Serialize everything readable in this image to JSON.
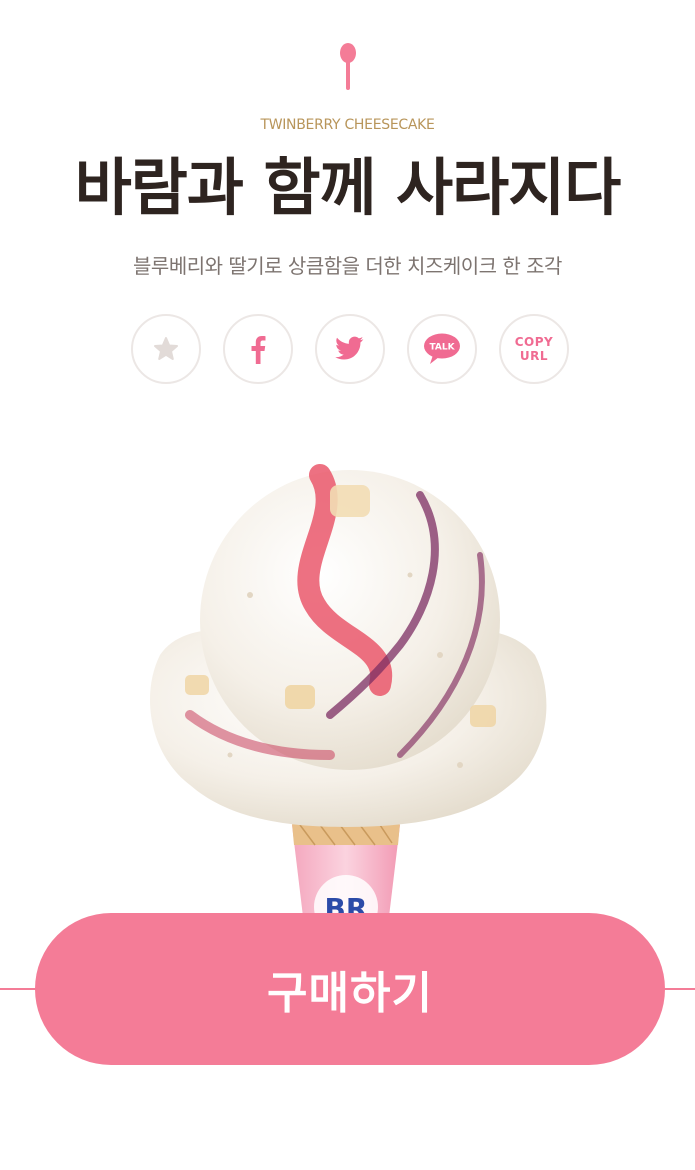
{
  "header": {
    "icon": "spoon-icon",
    "eng_title": "TWINBERRY CHEESECAKE",
    "kor_title": "바람과 함께 사라지다",
    "subtitle": "블루베리와 딸기로 상큼함을 더한 치즈케이크 한 조각"
  },
  "share": {
    "items": [
      {
        "name": "favorite",
        "icon": "star-icon"
      },
      {
        "name": "facebook",
        "icon": "facebook-icon"
      },
      {
        "name": "twitter",
        "icon": "twitter-icon"
      },
      {
        "name": "kakaotalk",
        "icon": "talk-icon",
        "label": "TALK"
      },
      {
        "name": "copy-url",
        "icon": "copy-url-icon",
        "label_top": "COPY",
        "label_bottom": "URL"
      }
    ]
  },
  "product": {
    "image": "ice-cream-cone",
    "cone_logo": "BR"
  },
  "buy": {
    "label": "구매하기"
  },
  "colors": {
    "accent": "#f47c97",
    "title": "#2e2420",
    "eng_title": "#b8955a",
    "subtitle": "#7d7470"
  }
}
